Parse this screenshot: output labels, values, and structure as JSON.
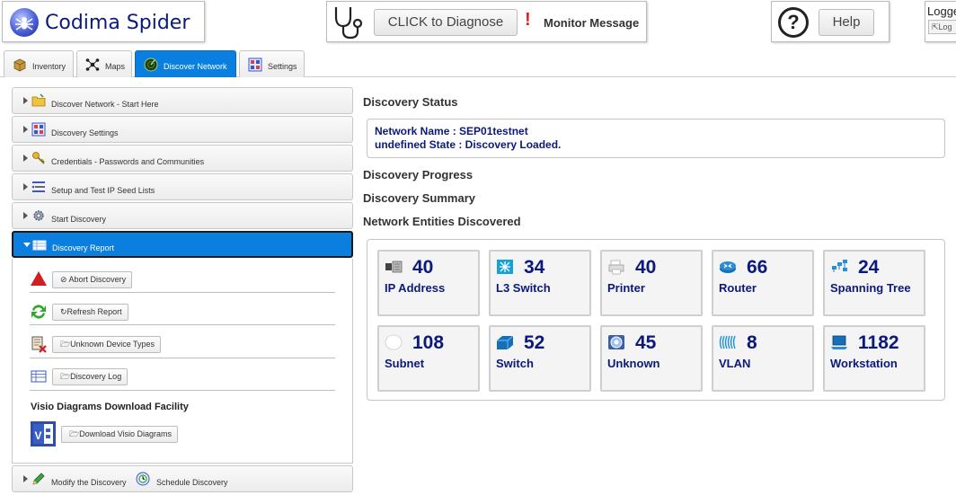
{
  "header": {
    "app_title": "Codima Spider",
    "diagnose_label": "CLICK to Diagnose",
    "alert_mark": "!",
    "monitor_label": "Monitor Message",
    "help_label": "Help",
    "help_symbol": "?",
    "logged_label": "Logge",
    "logout_label": "Log"
  },
  "tabs": [
    {
      "label": "Inventory",
      "icon": "box-icon"
    },
    {
      "label": "Maps",
      "icon": "network-nodes-icon"
    },
    {
      "label": "Discover Network",
      "icon": "radar-icon",
      "active": true
    },
    {
      "label": "Settings",
      "icon": "settings-grid-icon"
    }
  ],
  "accordion": [
    {
      "label": "Discover Network - Start Here",
      "icon": "folder-icon"
    },
    {
      "label": "Discovery Settings",
      "icon": "settings-grid-icon"
    },
    {
      "label": "Credentials - Passwords and Communities",
      "icon": "key-icon"
    },
    {
      "label": "Setup and Test IP Seed Lists",
      "icon": "list-icon"
    },
    {
      "label": "Start Discovery",
      "icon": "gear-icon"
    },
    {
      "label": "Discovery Report",
      "icon": "table-icon",
      "active": true
    }
  ],
  "report_actions": {
    "abort": "Abort Discovery",
    "refresh": "Refresh Report",
    "unknown": "Unknown Device Types",
    "log": "Discovery Log",
    "visio_title": "Visio Diagrams Download Facility",
    "visio_button": "Download Visio Diagrams"
  },
  "bottom_bar": {
    "modify": "Modify the Discovery",
    "schedule": "Schedule Discovery"
  },
  "content": {
    "status_title": "Discovery Status",
    "network_name_line": "Network Name : SEP01testnet",
    "state_line": "undefined State : Discovery Loaded.",
    "progress_title": "Discovery Progress",
    "summary_title": "Discovery Summary",
    "entities_title": "Network Entities Discovered"
  },
  "entities": [
    {
      "count": "40",
      "label": "IP Address",
      "icon": "ip-address-icon"
    },
    {
      "count": "34",
      "label": "L3 Switch",
      "icon": "l3-switch-icon"
    },
    {
      "count": "40",
      "label": "Printer",
      "icon": "printer-icon"
    },
    {
      "count": "66",
      "label": "Router",
      "icon": "router-icon"
    },
    {
      "count": "24",
      "label": "Spanning Tree",
      "icon": "spanning-tree-icon"
    },
    {
      "count": "108",
      "label": "Subnet",
      "icon": "subnet-icon"
    },
    {
      "count": "52",
      "label": "Switch",
      "icon": "switch-icon"
    },
    {
      "count": "45",
      "label": "Unknown",
      "icon": "unknown-device-icon"
    },
    {
      "count": "8",
      "label": "VLAN",
      "icon": "vlan-icon"
    },
    {
      "count": "1182",
      "label": "Workstation",
      "icon": "workstation-icon"
    }
  ],
  "colors": {
    "accent_blue": "#0a7fe0",
    "text_navy": "#0b1a7a",
    "alert_red": "#e02020"
  }
}
